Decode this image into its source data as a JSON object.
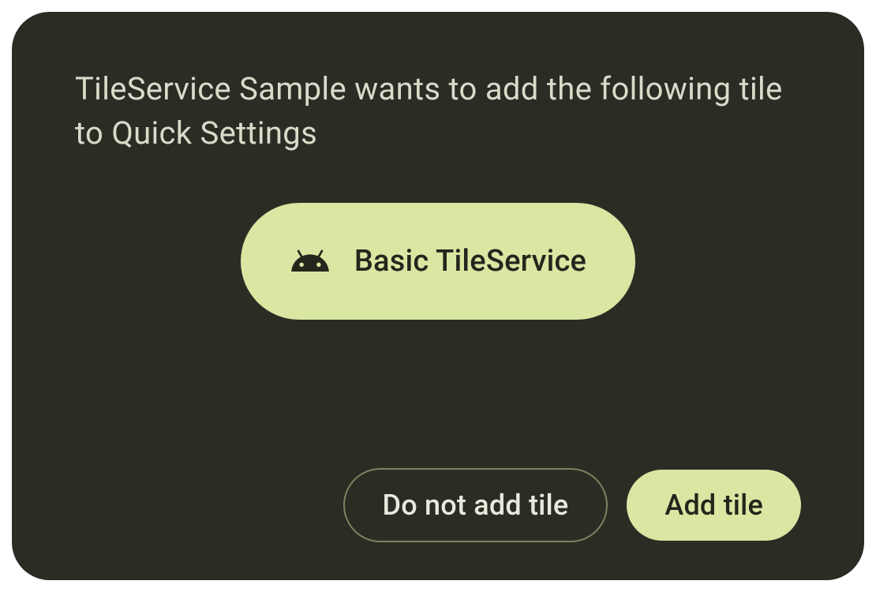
{
  "dialog": {
    "title": "TileService Sample wants to add the following tile to Quick Settings",
    "tile": {
      "icon_name": "android-icon",
      "label": "Basic TileService"
    },
    "actions": {
      "decline_label": "Do not add tile",
      "accept_label": "Add tile"
    }
  },
  "colors": {
    "dialog_bg": "#2c2c25",
    "accent": "#d9e7a3",
    "title_text": "#d8dcc9",
    "tile_text": "#24261c",
    "outline_border": "#7a8560",
    "outline_text": "#e8eadc"
  }
}
